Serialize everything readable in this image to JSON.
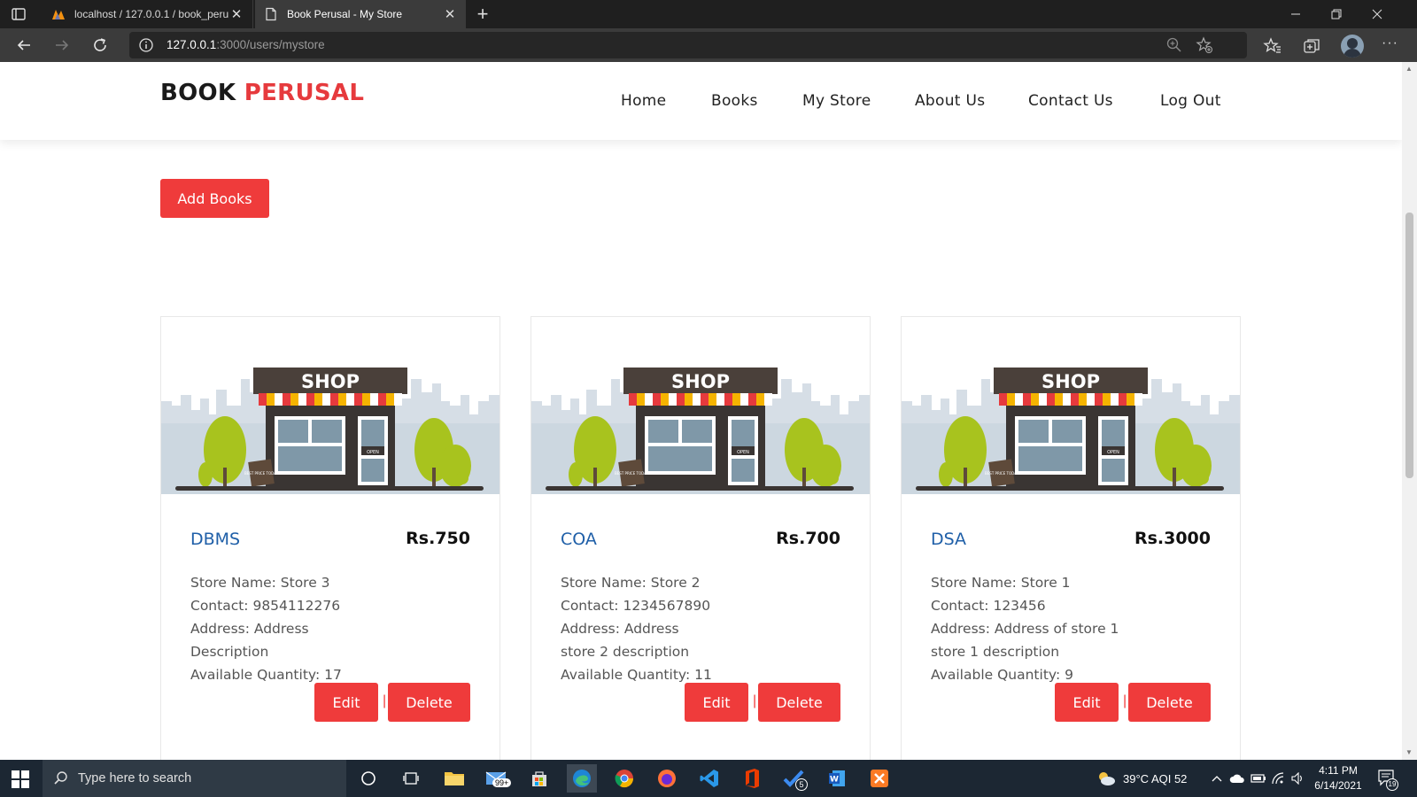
{
  "browser": {
    "tabs": [
      {
        "title": "localhost / 127.0.0.1 / book_peru",
        "active": false
      },
      {
        "title": "Book Perusal - My Store",
        "active": true
      }
    ],
    "new_tab_label": "+",
    "url_host": "127.0.0.1",
    "url_path": ":3000/users/mystore"
  },
  "site": {
    "logo_part1": "BOOK",
    "logo_part2": "PERUSAL",
    "nav": [
      "Home",
      "Books",
      "My Store",
      "About Us",
      "Contact Us",
      "Log Out"
    ],
    "add_button": "Add Books",
    "card_image_label": "SHOP",
    "card_sign_label": "BEST PRICE TODAY",
    "card_open_label": "OPEN",
    "edit_label": "Edit",
    "separator": "|",
    "delete_label": "Delete"
  },
  "books": [
    {
      "name": "DBMS",
      "price": "Rs.750",
      "store": "Store Name: Store 3",
      "contact": "Contact: 9854112276",
      "address": "Address: Address",
      "description": "Description",
      "quantity": "Available Quantity: 17"
    },
    {
      "name": "COA",
      "price": "Rs.700",
      "store": "Store Name: Store 2",
      "contact": "Contact: 1234567890",
      "address": "Address: Address",
      "description": "store 2 description",
      "quantity": "Available Quantity: 11"
    },
    {
      "name": "DSA",
      "price": "Rs.3000",
      "store": "Store Name: Store 1",
      "contact": "Contact: 123456",
      "address": "Address: Address of store 1",
      "description": "store 1 description",
      "quantity": "Available Quantity: 9"
    }
  ],
  "taskbar": {
    "search_placeholder": "Type here to search",
    "mail_badge": "99+",
    "todo_badge": "5",
    "weather": "39°C  AQI 52",
    "time": "4:11 PM",
    "date": "6/14/2021",
    "notifications": "19"
  },
  "colors": {
    "accent": "#ef3b3b",
    "logo_red": "#e63a3d",
    "title_blue": "#1f5fa8"
  }
}
